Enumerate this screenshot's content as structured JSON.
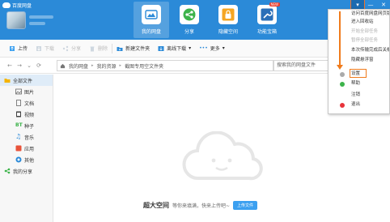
{
  "app": {
    "name": "百度网盘"
  },
  "colors": {
    "header_bg": "#2b8ad8",
    "accent_orange": "#f07b1c",
    "upload_button": "#3ca0f0"
  },
  "nav": [
    {
      "label": "我的网盘",
      "icon": "cloud-disk-icon",
      "active": true
    },
    {
      "label": "分享",
      "icon": "share-icon"
    },
    {
      "label": "隐藏空间",
      "icon": "lock-icon"
    },
    {
      "label": "功能宝箱",
      "icon": "toolbox-icon",
      "badge": "NEW"
    }
  ],
  "window_controls": {
    "menu": "▾",
    "minimize": "—",
    "close": "✕"
  },
  "toolbar": {
    "upload": "上传",
    "download": "下载",
    "share": "分享",
    "delete": "删除",
    "new_folder": "新建文件夹",
    "offline_download": "离线下载",
    "offline_arrow": "▾",
    "more": "更多",
    "more_arrow": "▾"
  },
  "addressbar": {
    "back": "←",
    "forward": "→",
    "dropdown": "⌄",
    "refresh": "⟳",
    "breadcrumbs": [
      "我的网盘",
      "我的资源",
      "截图专用空文件夹"
    ],
    "search_placeholder": "搜索我的网盘文件"
  },
  "sidebar": {
    "all_files": "全部文件",
    "categories": [
      "图片",
      "文档",
      "视频",
      "种子",
      "音乐",
      "应用",
      "其他"
    ],
    "my_shares": "我的分享"
  },
  "empty_state": {
    "headline": "超大空间",
    "message": "等你来填满，快来上传吧~",
    "upload_button": "上传文件"
  },
  "menu": {
    "items": [
      {
        "label": "访问百度网盘网页版",
        "enabled": true
      },
      {
        "label": "进入回收站",
        "enabled": true
      },
      {
        "label": "开始全部任务",
        "enabled": false
      },
      {
        "label": "暂停全部任务",
        "enabled": false
      },
      {
        "label": "本次传输完成后关机",
        "enabled": true
      },
      {
        "label": "隐藏悬浮窗",
        "enabled": true
      },
      {
        "label": "设置",
        "enabled": true,
        "icon": "gear-icon",
        "highlighted": true
      },
      {
        "label": "帮助",
        "enabled": true,
        "icon": "help-icon"
      },
      {
        "label": "注销",
        "enabled": true
      },
      {
        "label": "退出",
        "enabled": true,
        "icon": "power-icon"
      }
    ]
  }
}
